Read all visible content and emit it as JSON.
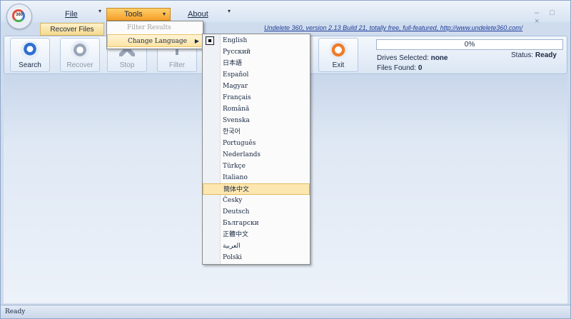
{
  "app": {
    "orb_text": "360"
  },
  "menubar": {
    "file": "File",
    "tools": "Tools",
    "about": "About",
    "window_controls": "– □ ×"
  },
  "tabs": {
    "recover_files": "Recover Files"
  },
  "homepage_link": "Undelete 360, version 2.13 Build 21, totally free, full-featured, http://www.undelete360.com/",
  "toolbar": {
    "search": "Search",
    "recover": "Recover",
    "stop": "Stop",
    "filter": "Filter",
    "exit": "Exit"
  },
  "progress": {
    "value": 0,
    "text": "0%"
  },
  "info": {
    "drives_label": "Drives Selected:",
    "drives_value": "none",
    "files_label": "Files Found:",
    "files_value": "0",
    "status_label": "Status:",
    "status_value": "Ready"
  },
  "tools_menu": {
    "filter_results": "Filter Results",
    "change_language": "Change Language"
  },
  "languages": {
    "selected": "English",
    "highlighted": "簡体中文",
    "items": [
      "English",
      "Русский",
      "日本語",
      "Español",
      "Magyar",
      "Français",
      "Română",
      "Svenska",
      "한국어",
      "Português",
      "Nederlands",
      "Türkçe",
      "Italiano",
      "簡体中文",
      "Česky",
      "Deutsch",
      "Български",
      "正體中文",
      "العربية",
      "Polski"
    ]
  },
  "statusbar": {
    "text": "Ready"
  },
  "colors": {
    "accent_orange": "#f59f2a",
    "menu_highlight": "#fde7b0",
    "link_blue": "#1e3c98"
  }
}
